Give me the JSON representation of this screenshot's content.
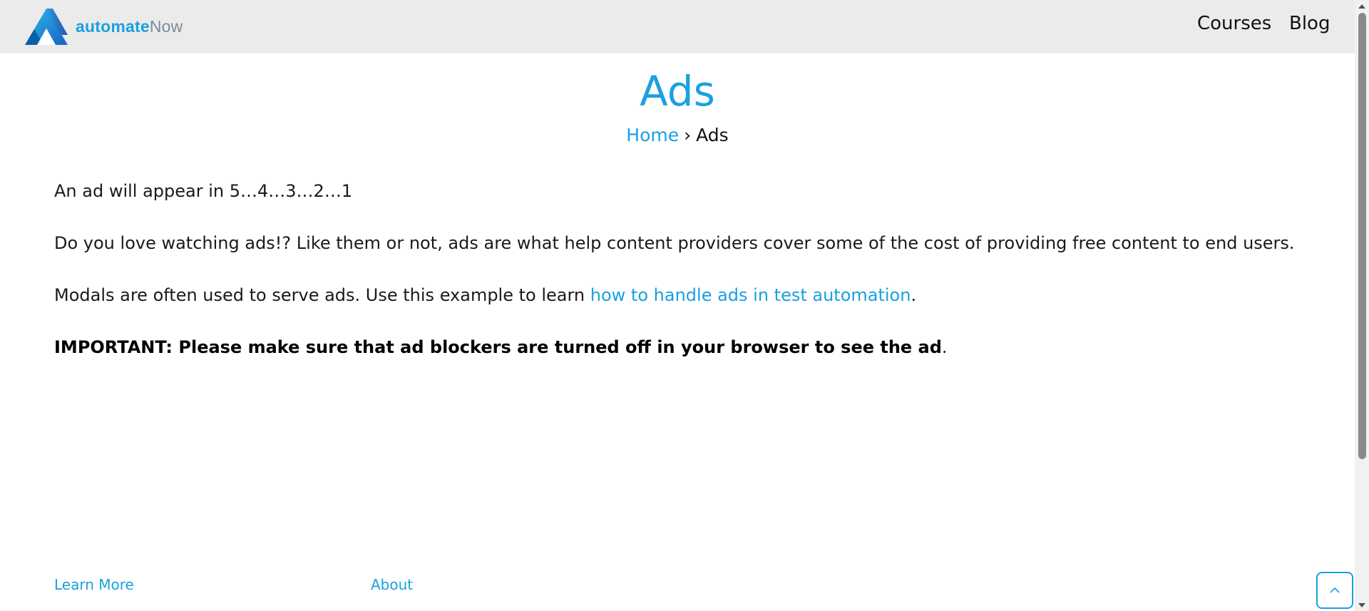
{
  "header": {
    "logo_part1": "automate",
    "logo_part2": "Now",
    "nav": [
      "Courses",
      "Blog"
    ]
  },
  "main": {
    "title": "Ads",
    "breadcrumb": {
      "home": "Home",
      "separator": "›",
      "current": "Ads"
    },
    "countdown_text": "An ad will appear in 5…4…3…2…1",
    "intro_text": "Do you love watching ads!? Like them or not, ads are what help content providers cover some of the cost of providing free content to end users.",
    "modal_text_before": "Modals are often used to serve ads. Use this example to learn ",
    "modal_link": "how to handle ads in test automation",
    "modal_text_after": ".",
    "important_text": "IMPORTANT: Please make sure that ad blockers are turned off in your browser to see the ad",
    "important_end": "."
  },
  "footer": {
    "learn_more": "Learn More",
    "about": "About"
  },
  "icons": {
    "back_to_top": "chevron-up-icon",
    "logo": "automatenow-logo-icon"
  },
  "colors": {
    "accent": "#1aa0e0",
    "header_bg": "#ebebeb",
    "logo_secondary": "#7d8b95"
  }
}
